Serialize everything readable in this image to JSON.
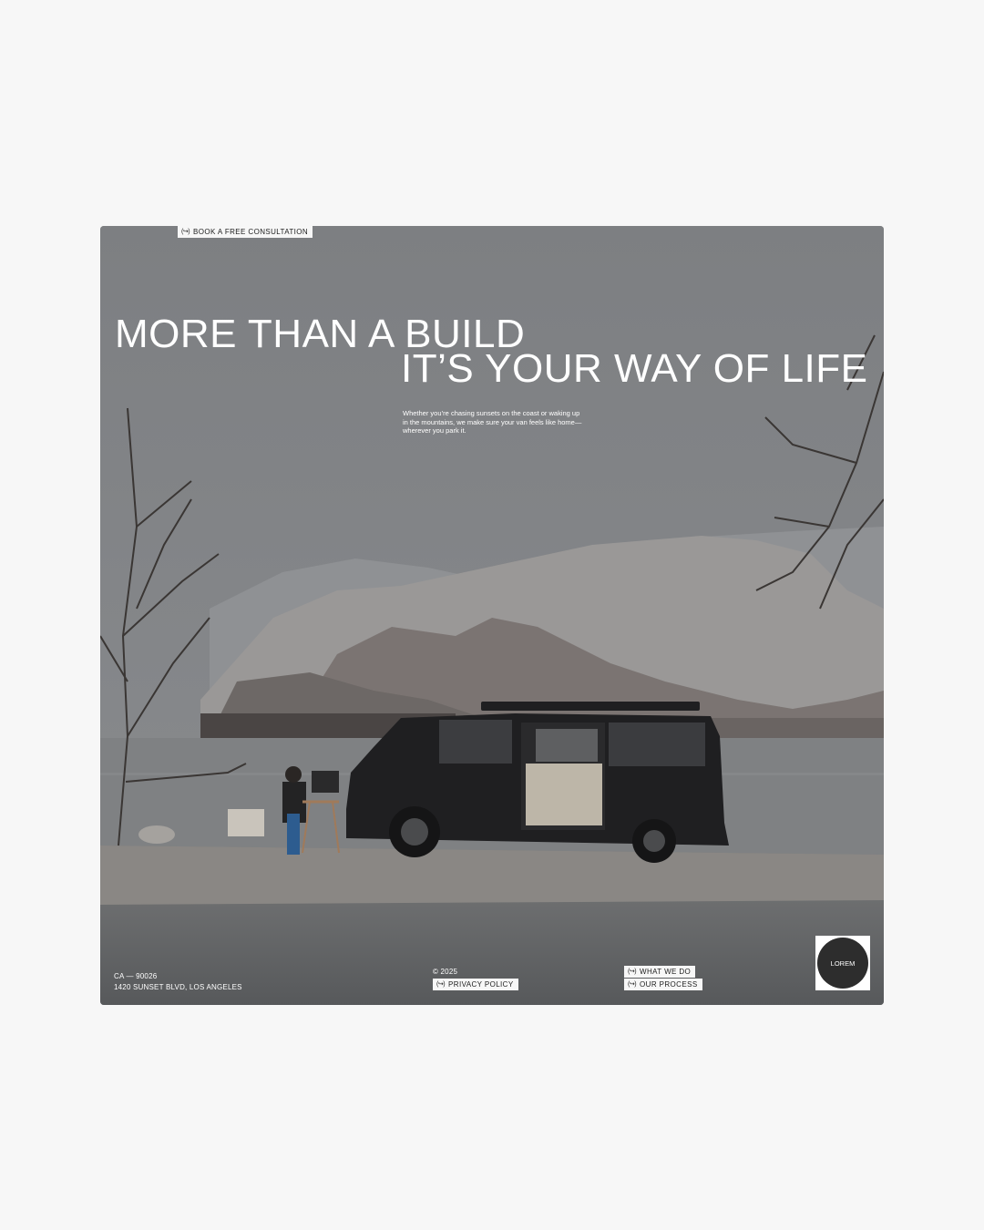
{
  "cta": {
    "icon": "arrow-circle-icon",
    "label": "BOOK A FREE CONSULTATION"
  },
  "headline": {
    "line1": "MORE THAN A BUILD",
    "line2": "IT’S YOUR WAY OF LIFE"
  },
  "subtext": "Whether you’re chasing sunsets on the coast or waking up in the mountains, we make sure your van feels like home—wherever you park it.",
  "footer": {
    "address_line1": "CA — 90026",
    "address_line2": "1420 SUNSET BLVD, LOS ANGELES",
    "copyright": "© 2025",
    "privacy_label": "PRIVACY POLICY",
    "nav": [
      {
        "label": "WHAT WE DO"
      },
      {
        "label": "OUR PROCESS"
      }
    ],
    "logo_text": "LOREM"
  },
  "colors": {
    "page_bg": "#f7f7f7",
    "hero_overlay": "#808285",
    "text": "#ffffff",
    "tag_bg": "#f7f7f7"
  }
}
